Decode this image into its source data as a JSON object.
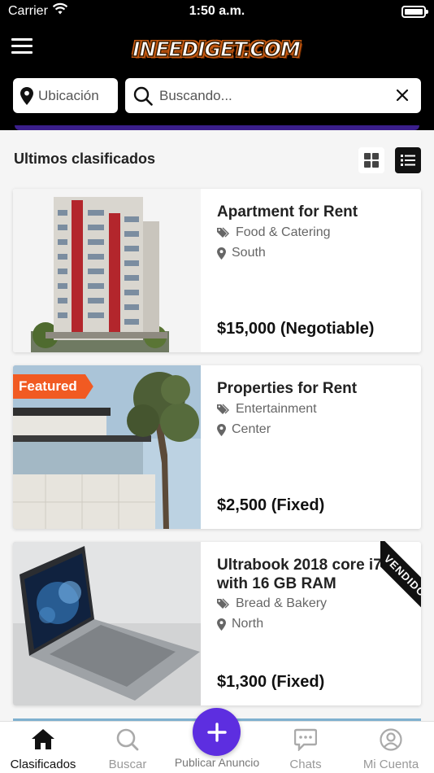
{
  "status_bar": {
    "carrier": "Carrier",
    "time": "1:50 a.m."
  },
  "header": {
    "logo_text": "INEEDIGET.COM",
    "location_label": "Ubicación",
    "search_placeholder": "Buscando..."
  },
  "section": {
    "title": "Ultimos clasificados",
    "view_mode": "list"
  },
  "listings": [
    {
      "title": "Apartment for Rent",
      "category": "Food & Catering",
      "location": "South",
      "price": "$15,000 (Negotiable)"
    },
    {
      "title": "Properties for Rent",
      "category": "Entertainment",
      "location": "Center",
      "price": "$2,500 (Fixed)",
      "badge": "Featured"
    },
    {
      "title": "Ultrabook 2018 core i7 with 16 GB RAM",
      "category": "Bread & Bakery",
      "location": "North",
      "price": "$1,300 (Fixed)",
      "ribbon": "VENDIDO"
    }
  ],
  "nav": {
    "tabs": [
      {
        "label": "Clasificados",
        "icon": "home-icon",
        "active": true
      },
      {
        "label": "Buscar",
        "icon": "search-icon"
      },
      {
        "label": "Publicar Anuncio",
        "icon": "plus-icon"
      },
      {
        "label": "Chats",
        "icon": "chat-icon"
      },
      {
        "label": "Mi Cuenta",
        "icon": "user-icon"
      }
    ]
  },
  "colors": {
    "header_bg": "#000000",
    "accent_purple": "#5d2ee0",
    "featured_orange": "#f15a22",
    "sold_ribbon": "#111111"
  }
}
